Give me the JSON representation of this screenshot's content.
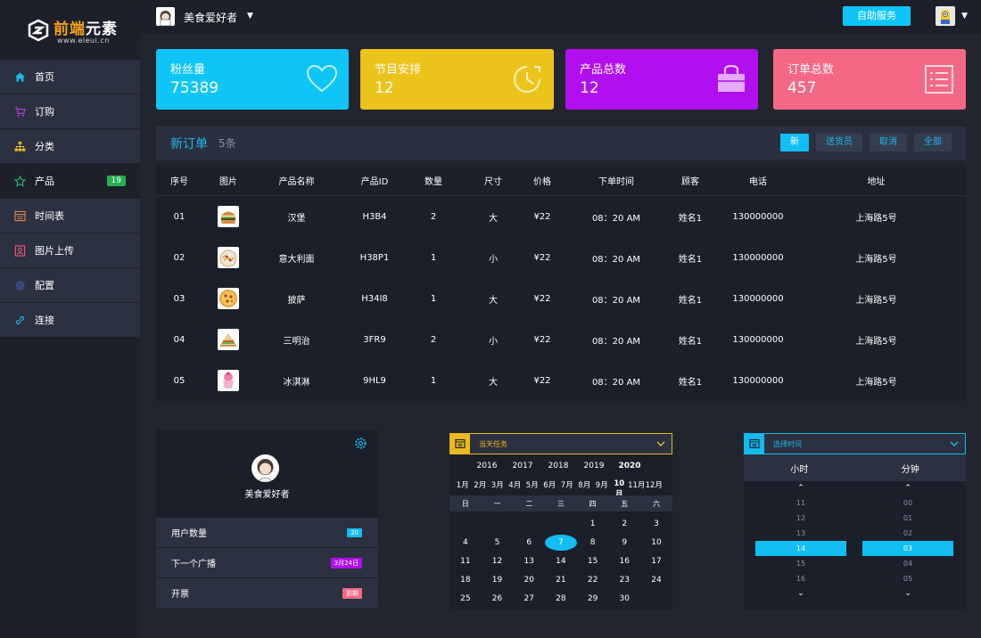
{
  "logo": {
    "brand_a": "前端",
    "brand_b": "元素",
    "sub": "www.eleui.cn"
  },
  "sidebar": {
    "items": [
      {
        "label": "首页"
      },
      {
        "label": "订购"
      },
      {
        "label": "分类"
      },
      {
        "label": "产品",
        "badge": "19"
      },
      {
        "label": "时间表"
      },
      {
        "label": "图片上传"
      },
      {
        "label": "配置"
      },
      {
        "label": "连接"
      }
    ]
  },
  "topbar": {
    "user": "美食爱好者",
    "help": "自助服务"
  },
  "stats": [
    {
      "title": "粉丝量",
      "value": "75389",
      "color": "#0fc5f7"
    },
    {
      "title": "节目安排",
      "value": "12",
      "color": "#ebc31b"
    },
    {
      "title": "产品总数",
      "value": "12",
      "color": "#b10fef"
    },
    {
      "title": "订单总数",
      "value": "457",
      "color": "#f56885"
    }
  ],
  "orders": {
    "title": "新订单",
    "count": "5条",
    "filters": [
      "新",
      "送货员",
      "取消",
      "全部"
    ],
    "headers": [
      "序号",
      "图片",
      "产品名称",
      "产品ID",
      "数量",
      "尺寸",
      "价格",
      "下单时间",
      "顾客",
      "电话",
      "地址"
    ],
    "rows": [
      [
        "01",
        "",
        "汉堡",
        "H3B4",
        "2",
        "大",
        "¥22",
        "08：20 AM",
        "姓名1",
        "130000000",
        "上海路5号"
      ],
      [
        "02",
        "",
        "意大利面",
        "H38P1",
        "1",
        "小",
        "¥22",
        "08：20 AM",
        "姓名1",
        "130000000",
        "上海路5号"
      ],
      [
        "03",
        "",
        "披萨",
        "H34I8",
        "1",
        "大",
        "¥22",
        "08：20 AM",
        "姓名1",
        "130000000",
        "上海路5号"
      ],
      [
        "04",
        "",
        "三明治",
        "3FR9",
        "2",
        "小",
        "¥22",
        "08：20 AM",
        "姓名1",
        "130000000",
        "上海路5号"
      ],
      [
        "05",
        "",
        "冰淇淋",
        "9HL9",
        "1",
        "大",
        "¥22",
        "08：20 AM",
        "姓名1",
        "130000000",
        "上海路5号"
      ]
    ]
  },
  "profile": {
    "name": "美食爱好者",
    "rows": [
      {
        "label": "用户数量",
        "badge": "20",
        "color": "#12bdf2"
      },
      {
        "label": "下一个广播",
        "badge": "3月24日",
        "color": "#b10fef"
      },
      {
        "label": "开票",
        "badge": "到期",
        "color": "#f56885"
      }
    ]
  },
  "calendar": {
    "title": "当天任务",
    "years": [
      "2016",
      "2017",
      "2018",
      "2019",
      "2020"
    ],
    "months": [
      "1月",
      "2月",
      "3月",
      "4月",
      "5月",
      "6月",
      "7月",
      "8月",
      "9月",
      "10月",
      "11月",
      "12月"
    ],
    "weekdays": [
      "日",
      "一",
      "二",
      "三",
      "四",
      "五",
      "六"
    ],
    "weeks": [
      [
        "",
        "",
        "",
        "",
        "1",
        "2",
        "3"
      ],
      [
        "4",
        "5",
        "6",
        "7",
        "8",
        "9",
        "10"
      ],
      [
        "11",
        "12",
        "13",
        "14",
        "15",
        "16",
        "17"
      ],
      [
        "18",
        "19",
        "20",
        "21",
        "22",
        "23",
        "24"
      ],
      [
        "25",
        "26",
        "27",
        "28",
        "29",
        "30",
        ""
      ]
    ],
    "today": "7"
  },
  "timepicker": {
    "title": "选择时间",
    "hour_label": "小时",
    "minute_label": "分钟",
    "hours": [
      "11",
      "12",
      "13",
      "14",
      "15",
      "16"
    ],
    "minutes": [
      "00",
      "01",
      "02",
      "03",
      "04",
      "05"
    ],
    "selected_hour": "14",
    "selected_minute": "03"
  }
}
